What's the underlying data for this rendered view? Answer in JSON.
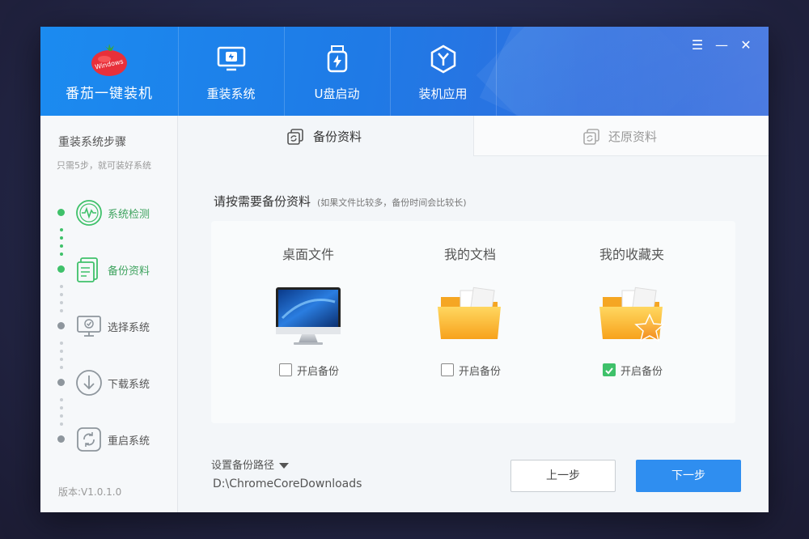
{
  "app": {
    "name": "番茄一键装机"
  },
  "nav": {
    "tabs": [
      {
        "label": "重装系统",
        "icon": "monitor-refresh-icon"
      },
      {
        "label": "U盘启动",
        "icon": "usb-drive-icon"
      },
      {
        "label": "装机应用",
        "icon": "app-hexagon-icon"
      }
    ]
  },
  "window_controls": {
    "menu": "☰",
    "minimize": "—",
    "close": "✕"
  },
  "sidebar": {
    "title": "重装系统步骤",
    "subtitle": "只需5步，就可装好系统",
    "steps": [
      {
        "label": "系统检测",
        "state": "done",
        "icon": "system-check-icon"
      },
      {
        "label": "备份资料",
        "state": "done",
        "icon": "backup-document-icon"
      },
      {
        "label": "选择系统",
        "state": "pending",
        "icon": "select-system-icon"
      },
      {
        "label": "下载系统",
        "state": "pending",
        "icon": "download-icon"
      },
      {
        "label": "重启系统",
        "state": "pending",
        "icon": "restart-icon"
      }
    ],
    "version": "版本:V1.0.1.0"
  },
  "content": {
    "tabs": [
      {
        "label": "备份资料",
        "active": true
      },
      {
        "label": "还原资料",
        "active": false
      }
    ],
    "prompt": "请按需要备份资料",
    "prompt_note": "(如果文件比较多，备份时间会比较长)",
    "items": [
      {
        "title": "桌面文件",
        "checkbox_label": "开启备份",
        "checked": false,
        "icon": "desktop-monitor-icon"
      },
      {
        "title": "我的文档",
        "checkbox_label": "开启备份",
        "checked": false,
        "icon": "documents-folder-icon"
      },
      {
        "title": "我的收藏夹",
        "checkbox_label": "开启备份",
        "checked": true,
        "icon": "favorites-folder-icon"
      }
    ],
    "path_setting_label": "设置备份路径",
    "path_value": "D:\\ChromeCoreDownloads",
    "prev_button": "上一步",
    "next_button": "下一步"
  },
  "colors": {
    "header_blue": "#1f7ae6",
    "accent_green": "#3fc16a",
    "primary_button": "#2f8ef0"
  }
}
